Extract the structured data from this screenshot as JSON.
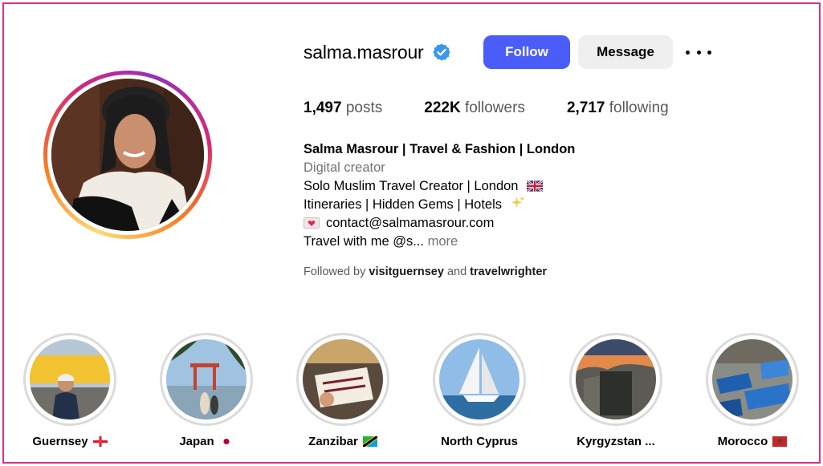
{
  "profile": {
    "username": "salma.masrour",
    "follow_label": "Follow",
    "message_label": "Message",
    "stats": {
      "posts_count": "1,497",
      "posts_label": "posts",
      "followers_count": "222K",
      "followers_label": "followers",
      "following_count": "2,717",
      "following_label": "following"
    },
    "bio": {
      "name": "Salma Masrour | Travel & Fashion | London",
      "category": "Digital creator",
      "line1": "Solo Muslim Travel Creator | London",
      "line2": "Itineraries | Hidden Gems | Hotels",
      "line3": "contact@salmamasrour.com",
      "line4": "Travel with me @s...",
      "more": "more"
    },
    "followed_by": {
      "prefix": "Followed by",
      "user1": "visitguernsey",
      "conj": "and",
      "user2": "travelwrighter"
    }
  },
  "highlights": [
    {
      "label": "Guernsey"
    },
    {
      "label": "Japan"
    },
    {
      "label": "Zanzibar"
    },
    {
      "label": "North Cyprus"
    },
    {
      "label": "Kyrgyzstan ..."
    },
    {
      "label": "Morocco"
    }
  ],
  "colors": {
    "follow_button": "#4a5df9",
    "verified_badge": "#3897f0",
    "frame_border": "#d6338a"
  }
}
